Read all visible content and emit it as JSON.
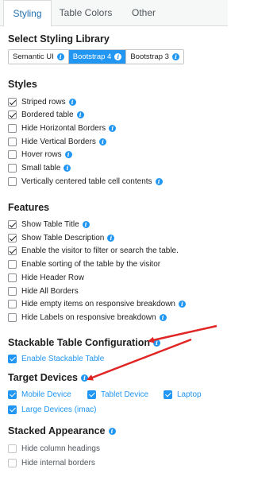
{
  "tabs": [
    {
      "label": "Styling",
      "active": true
    },
    {
      "label": "Table Colors",
      "active": false
    },
    {
      "label": "Other",
      "active": false
    }
  ],
  "library": {
    "title": "Select Styling Library",
    "options": [
      {
        "label": "Semantic UI",
        "active": false
      },
      {
        "label": "Bootstrap 4",
        "active": true
      },
      {
        "label": "Bootstrap 3",
        "active": false
      }
    ]
  },
  "styles": {
    "title": "Styles",
    "items": [
      {
        "label": "Striped rows",
        "checked": true,
        "info": true
      },
      {
        "label": "Bordered table",
        "checked": true,
        "info": true
      },
      {
        "label": "Hide Horizontal Borders",
        "checked": false,
        "info": true
      },
      {
        "label": "Hide Vertical Borders",
        "checked": false,
        "info": true
      },
      {
        "label": "Hover rows",
        "checked": false,
        "info": true
      },
      {
        "label": "Small table",
        "checked": false,
        "info": true
      },
      {
        "label": "Vertically centered table cell contents",
        "checked": false,
        "info": true
      }
    ]
  },
  "features": {
    "title": "Features",
    "items": [
      {
        "label": "Show Table Title",
        "checked": true,
        "info": true
      },
      {
        "label": "Show Table Description",
        "checked": true,
        "info": true
      },
      {
        "label": "Enable the visitor to filter or search the table.",
        "checked": true,
        "info": false
      },
      {
        "label": "Enable sorting of the table by the visitor",
        "checked": false,
        "info": false
      },
      {
        "label": "Hide Header Row",
        "checked": false,
        "info": false
      },
      {
        "label": "Hide All Borders",
        "checked": false,
        "info": false
      },
      {
        "label": "Hide empty items on responsive breakdown",
        "checked": false,
        "info": true
      },
      {
        "label": "Hide Labels on responsive breakdown",
        "checked": false,
        "info": true
      }
    ]
  },
  "stackable": {
    "title": "Stackable Table Configuration",
    "enable_label": "Enable Stackable Table",
    "enable_checked": true
  },
  "target_devices": {
    "title": "Target Devices",
    "items": [
      {
        "label": "Mobile Device",
        "checked": true
      },
      {
        "label": "Tablet Device",
        "checked": true
      },
      {
        "label": "Laptop",
        "checked": true
      },
      {
        "label": "Large Devices (imac)",
        "checked": true
      }
    ]
  },
  "stacked_appearance": {
    "title": "Stacked Appearance",
    "items": [
      {
        "label": "Hide column headings",
        "checked": false
      },
      {
        "label": "Hide internal borders",
        "checked": false
      }
    ]
  },
  "colors": {
    "accent": "#2196f3",
    "arrow": "#e02424",
    "tab_active_text": "#2271b1"
  },
  "icons": {
    "info": "info-circle-icon",
    "check": "checkmark-icon",
    "arrow": "red-arrow-annotation"
  }
}
